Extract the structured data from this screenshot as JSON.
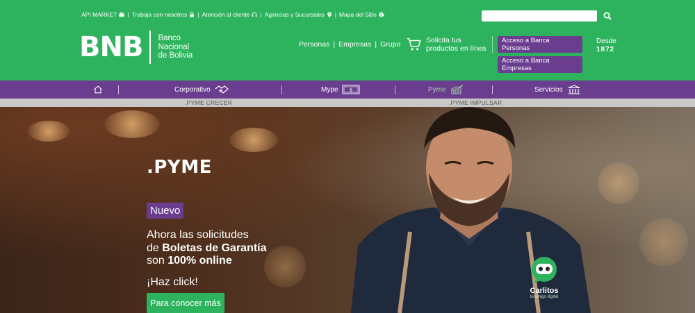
{
  "header": {
    "top_links": [
      {
        "label": "API MARKET",
        "icon": "briefcase-icon"
      },
      {
        "label": "Trabaja con nosotros",
        "icon": "lock-icon"
      },
      {
        "label": "Atención al cliente",
        "icon": "headset-icon"
      },
      {
        "label": "Agencias y Sucursales",
        "icon": "location-pin-icon"
      },
      {
        "label": "Mapa del Sitio",
        "icon": "globe-icon"
      }
    ],
    "separator": "|",
    "search": {
      "value": "",
      "placeholder": ""
    },
    "logo": {
      "mark": "BNB",
      "line1": "Banco",
      "line2": "Nacional",
      "line3": "de Bolivia"
    },
    "main_nav": [
      "Personas",
      "Empresas",
      "Grupo"
    ],
    "nav_separator": "|",
    "cart_line1": "Solicita tus",
    "cart_line2": "productos en línea",
    "btn_personas": "Acceso a Banca Personas",
    "btn_empresas": "Acceso a Banca Empresas",
    "since_label": "Desde",
    "since_year": "1872"
  },
  "purple_nav": {
    "home_icon": "home-icon",
    "items": [
      {
        "label": "Corporativo",
        "icon": "handshake-icon"
      },
      {
        "label": "Mype",
        "icon": "money-bill-icon"
      },
      {
        "label": "Pyme",
        "icon": "chart-icon",
        "active": true
      },
      {
        "label": "Servicios",
        "icon": "bank-building-icon"
      }
    ]
  },
  "sub_nav": [
    ".PYME CRECER",
    ".PYME IMPULSAR"
  ],
  "hero": {
    "title": ".PYME",
    "badge": "Nuevo",
    "line1": "Ahora las solicitudes",
    "line2_prefix": "de ",
    "line2_bold": "Boletas de Garantía",
    "line3_prefix": "son ",
    "line3_bold": "100% online",
    "click_text": "¡Haz click!",
    "cta": "Para conocer más"
  },
  "chatbot": {
    "name": "Carlitos",
    "tagline": "tu amigo digital"
  },
  "colors": {
    "brand_green": "#2db35d",
    "brand_purple": "#6a3d8f"
  }
}
